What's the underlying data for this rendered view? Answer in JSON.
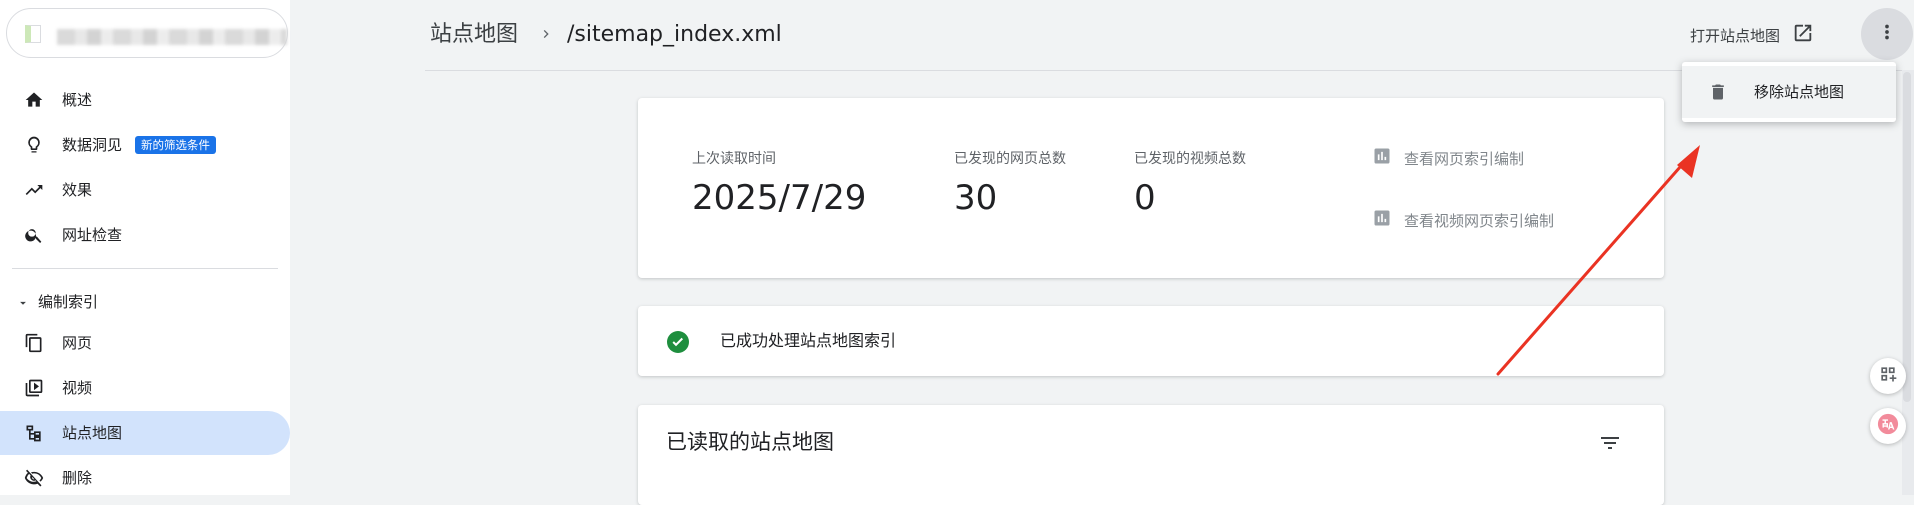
{
  "sidebar": {
    "items": [
      {
        "label": "概述",
        "icon": "home-icon"
      },
      {
        "label": "数据洞见",
        "icon": "lightbulb-icon",
        "badge": "新的筛选条件"
      },
      {
        "label": "效果",
        "icon": "trending-up-icon"
      },
      {
        "label": "网址检查",
        "icon": "search-icon"
      }
    ],
    "section_label": "编制索引",
    "section_items": [
      {
        "label": "网页",
        "icon": "pages-icon"
      },
      {
        "label": "视频",
        "icon": "video-icon"
      },
      {
        "label": "站点地图",
        "icon": "sitemap-icon",
        "active": true
      },
      {
        "label": "删除",
        "icon": "visibility-off-icon"
      }
    ]
  },
  "header": {
    "breadcrumb_root": "站点地图",
    "breadcrumb_current": "/sitemap_index.xml",
    "open_sitemap_label": "打开站点地图"
  },
  "stats": {
    "last_read_label": "上次读取时间",
    "last_read_value": "2025/7/29",
    "pages_label": "已发现的网页总数",
    "pages_value": "30",
    "videos_label": "已发现的视频总数",
    "videos_value": "0",
    "view_pages_link": "查看网页索引编制",
    "view_videos_link": "查看视频网页索引编制"
  },
  "status": {
    "message": "已成功处理站点地图索引"
  },
  "list": {
    "title": "已读取的站点地图"
  },
  "menu": {
    "remove_label": "移除站点地图"
  },
  "colors": {
    "active_nav": "#d2e3fc",
    "badge": "#1a73e8",
    "success": "#1e8e3e",
    "arrow": "#ea3323"
  }
}
